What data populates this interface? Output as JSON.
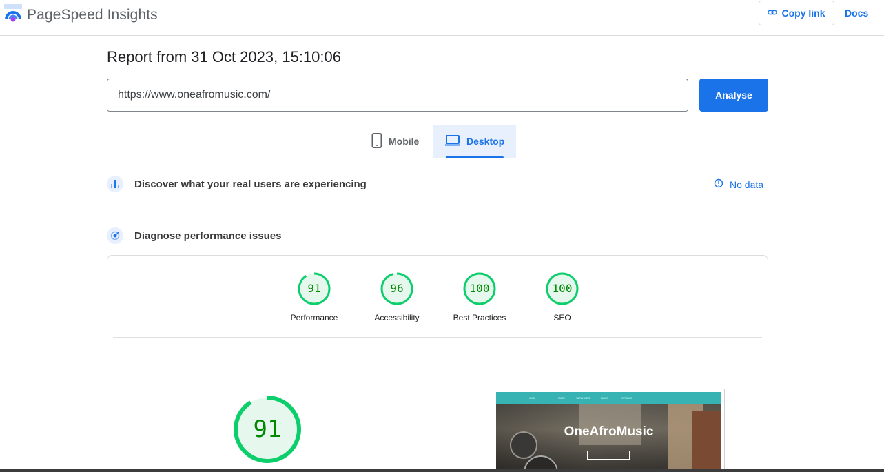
{
  "header": {
    "app_title": "PageSpeed Insights",
    "copy_link_label": "Copy link",
    "docs_label": "Docs"
  },
  "report": {
    "title": "Report from 31 Oct 2023, 15:10:06"
  },
  "search": {
    "url_value": "https://www.oneafromusic.com/",
    "analyse_label": "Analyse"
  },
  "device_tabs": [
    {
      "label": "Mobile",
      "icon": "smartphone-icon",
      "selected": false
    },
    {
      "label": "Desktop",
      "icon": "laptop-icon",
      "selected": true
    }
  ],
  "sections": {
    "real_users": {
      "title": "Discover what your real users are experiencing",
      "status": "No data",
      "icon": "users-chart-icon"
    },
    "diagnose": {
      "title": "Diagnose performance issues",
      "icon": "target-icon"
    }
  },
  "scores": [
    {
      "label": "Performance",
      "value": "91",
      "fraction": 0.91
    },
    {
      "label": "Accessibility",
      "value": "96",
      "fraction": 0.96
    },
    {
      "label": "Best Practices",
      "value": "100",
      "fraction": 1.0
    },
    {
      "label": "SEO",
      "value": "100",
      "fraction": 1.0
    }
  ],
  "main_score": {
    "value": "91",
    "fraction": 0.91
  },
  "colors": {
    "accent": "#1a73e8",
    "pass_green": "#0cce6b",
    "pass_green_text": "#008800",
    "pass_fill": "#e6f8ee"
  },
  "screenshot": {
    "site_title": "OneAfroMusic",
    "nav_items": [
      "OAM",
      "HOME",
      "SERVICES",
      "BLOG",
      "STUDIO"
    ]
  }
}
